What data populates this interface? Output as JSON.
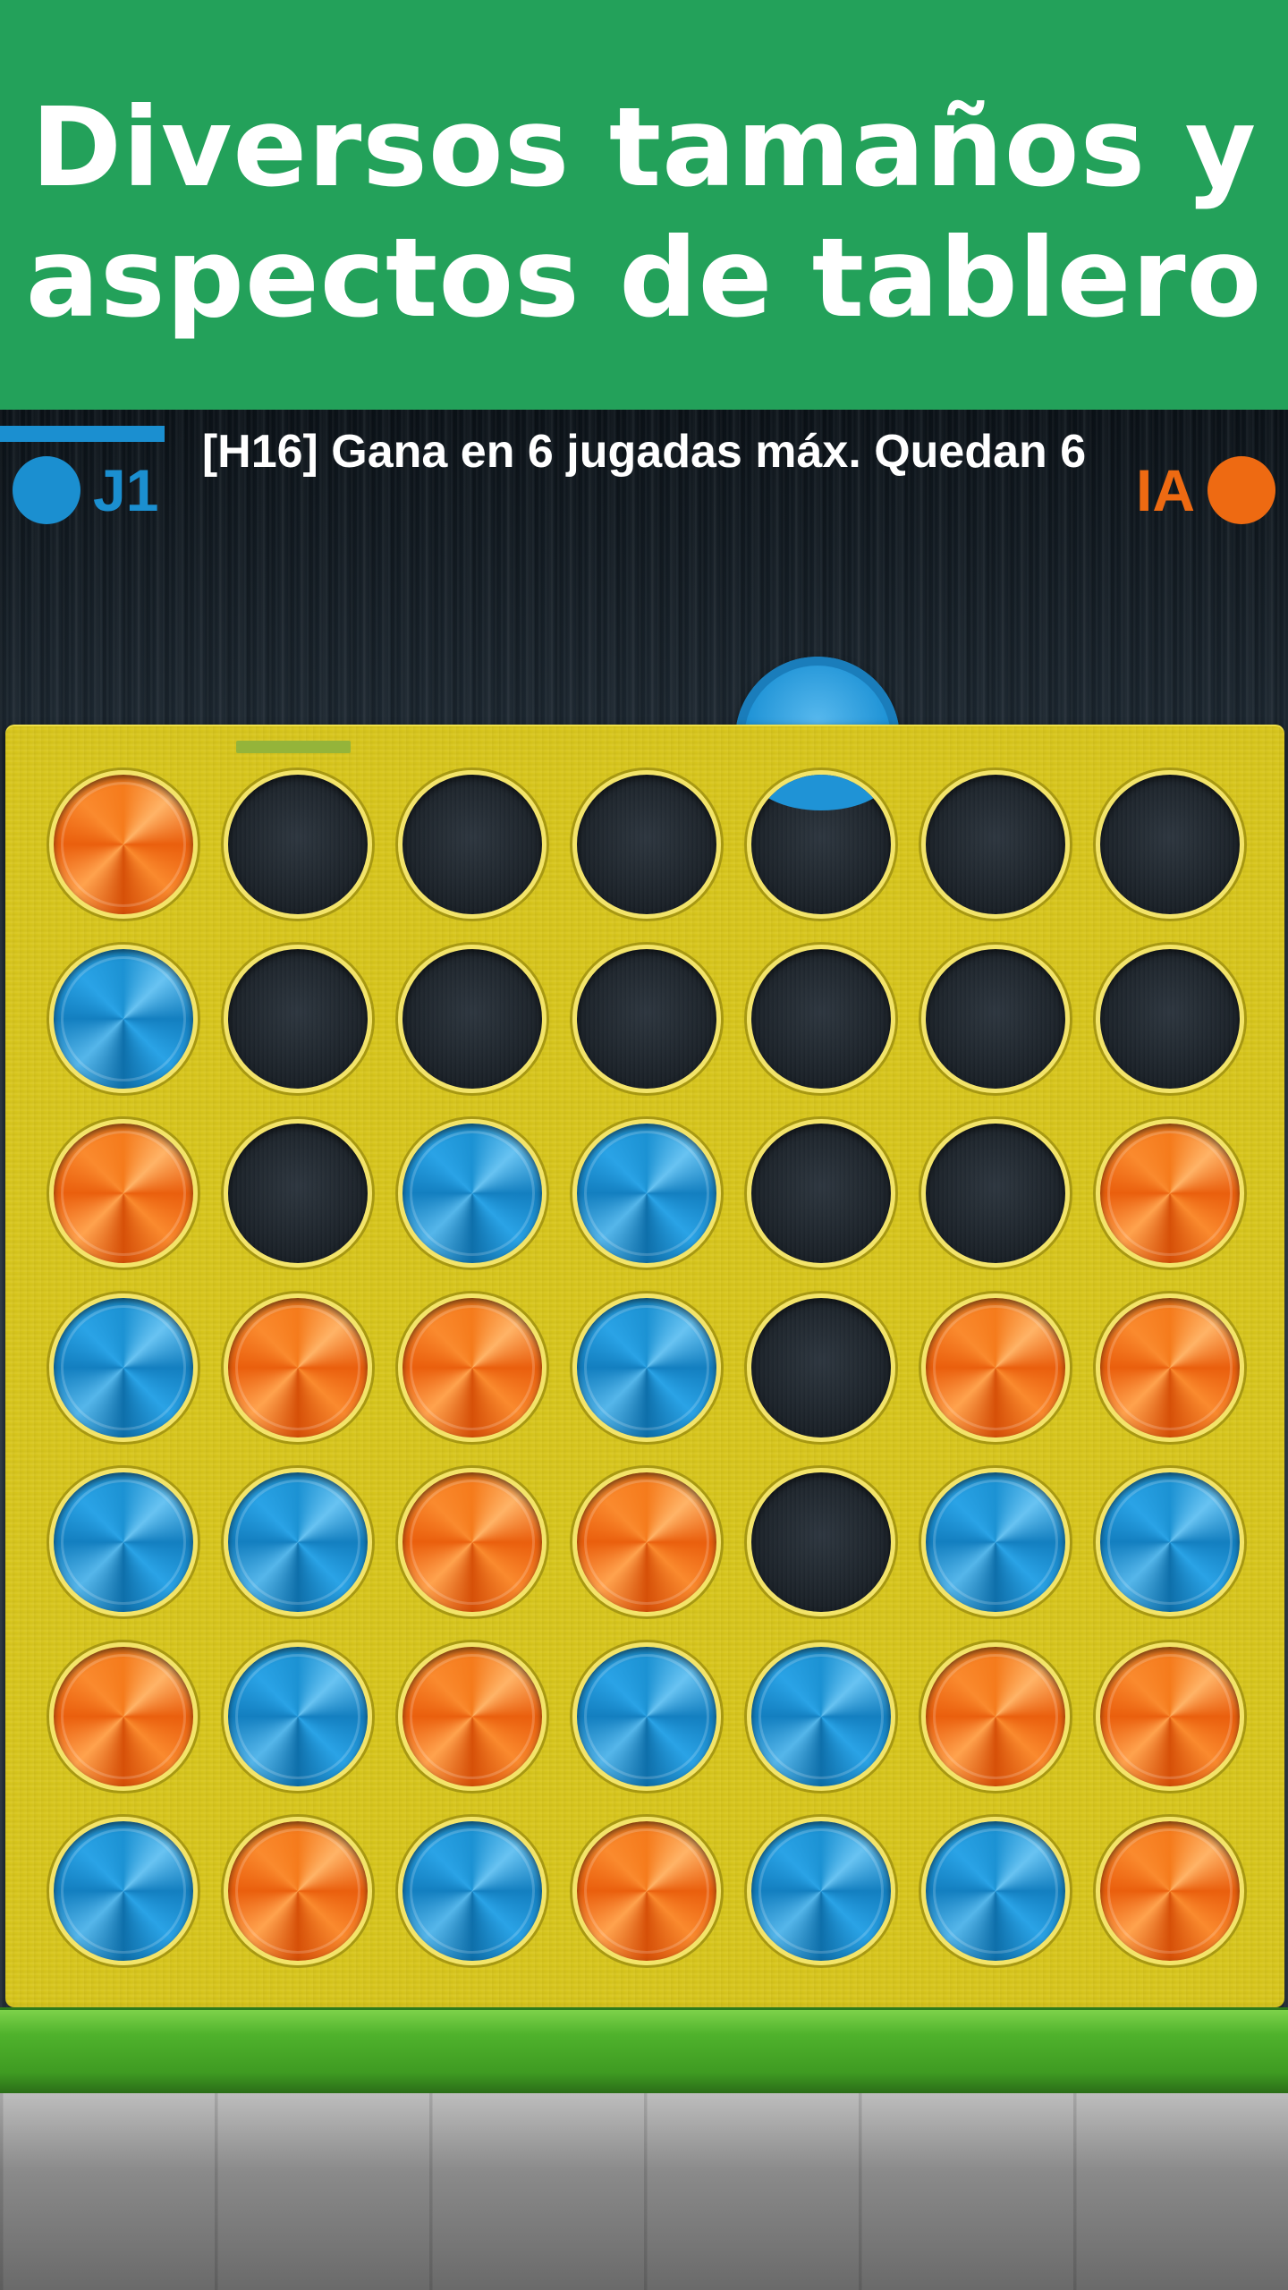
{
  "banner": {
    "line1": "Diversos tamaños y",
    "line2": "aspectos de tablero"
  },
  "header": {
    "status": "[H16] Gana en 6 jugadas máx. Quedan 6",
    "player1": {
      "name": "J1",
      "color": "#1b8fd0",
      "active": true
    },
    "player2": {
      "name": "IA",
      "color": "#ee6a12",
      "active": false
    }
  },
  "board": {
    "columns": 7,
    "rows": 7,
    "colors": {
      "board": "#d8c61c",
      "orange": "#ee6a12",
      "blue": "#1b8fd0",
      "stand": "#4fb22c"
    },
    "hover_column": 4,
    "hover_color": "blue",
    "highlighted_column": 1,
    "cells": [
      [
        "O",
        "E",
        "E",
        "E",
        "E",
        "E",
        "E"
      ],
      [
        "B",
        "E",
        "E",
        "E",
        "E",
        "E",
        "E"
      ],
      [
        "O",
        "E",
        "B",
        "B",
        "E",
        "E",
        "O"
      ],
      [
        "B",
        "O",
        "O",
        "B",
        "E",
        "O",
        "O"
      ],
      [
        "B",
        "B",
        "O",
        "O",
        "E",
        "B",
        "B"
      ],
      [
        "O",
        "B",
        "O",
        "B",
        "B",
        "O",
        "O"
      ],
      [
        "B",
        "O",
        "B",
        "O",
        "B",
        "B",
        "O"
      ]
    ]
  }
}
